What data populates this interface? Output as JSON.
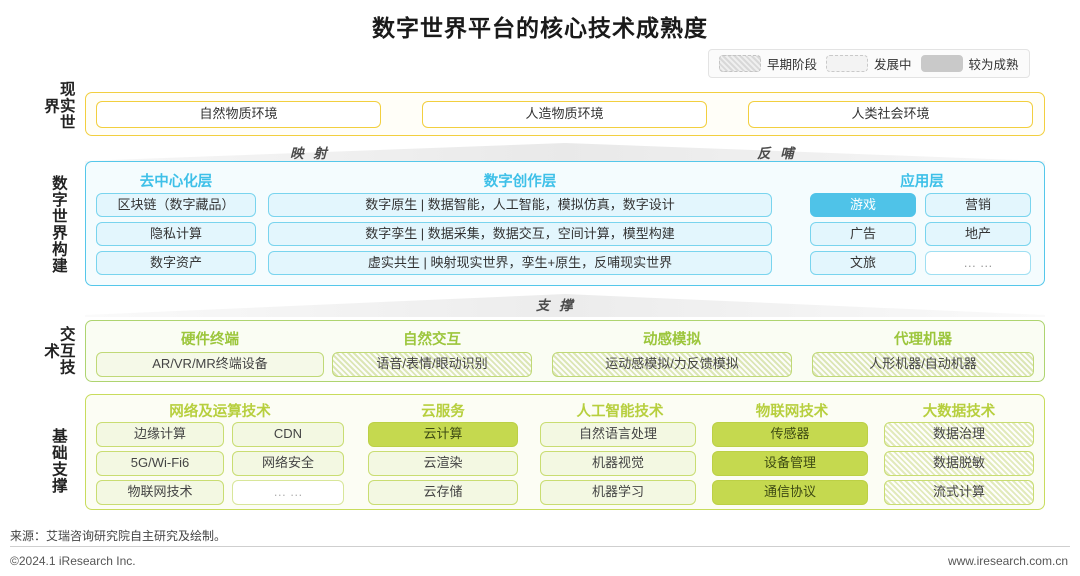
{
  "title": "数字世界平台的核心技术成熟度",
  "legend": {
    "items": [
      {
        "label": "早期阶段",
        "style": "early",
        "icon": "hatched-swatch"
      },
      {
        "label": "发展中",
        "style": "dev",
        "icon": "dashed-swatch"
      },
      {
        "label": "较为成熟",
        "style": "mature",
        "icon": "solid-swatch"
      }
    ]
  },
  "side_labels": {
    "reality": "现实世界",
    "digital": "数字世界构建",
    "interaction": "交互技术",
    "foundation": "基础支撑"
  },
  "bands": {
    "mapping": "映 射",
    "feedback": "反 哺",
    "support": "支 撑"
  },
  "reality": {
    "items": [
      {
        "label": "自然物质环境"
      },
      {
        "label": "人造物质环境"
      },
      {
        "label": "人类社会环境"
      }
    ]
  },
  "digital": {
    "columns": [
      {
        "header": "去中心化层",
        "items": [
          {
            "label": "区块链（数字藏品）",
            "state": "normal"
          },
          {
            "label": "隐私计算",
            "state": "normal"
          },
          {
            "label": "数字资产",
            "state": "normal"
          }
        ]
      },
      {
        "header": "数字创作层",
        "items": [
          {
            "label": "数字原生 | 数据智能，人工智能，模拟仿真，数字设计",
            "state": "normal"
          },
          {
            "label": "数字孪生 | 数据采集，数据交互，空间计算，模型构建",
            "state": "normal"
          },
          {
            "label": "虚实共生 | 映射现实世界，孪生+原生，反哺现实世界",
            "state": "normal"
          }
        ]
      },
      {
        "header": "应用层",
        "items": [
          {
            "label": "游戏",
            "state": "mature"
          },
          {
            "label": "营销",
            "state": "normal"
          },
          {
            "label": "广告",
            "state": "normal"
          },
          {
            "label": "地产",
            "state": "normal"
          },
          {
            "label": "文旅",
            "state": "normal"
          },
          {
            "label": "… …",
            "state": "dev"
          }
        ]
      }
    ]
  },
  "interaction": {
    "columns": [
      {
        "header": "硬件终端",
        "items": [
          {
            "label": "AR/VR/MR终端设备",
            "state": "plain"
          }
        ]
      },
      {
        "header": "自然交互",
        "items": [
          {
            "label": "语音/表情/眼动识别",
            "state": "early"
          }
        ]
      },
      {
        "header": "动感模拟",
        "items": [
          {
            "label": "运动感模拟/力反馈模拟",
            "state": "early"
          }
        ]
      },
      {
        "header": "代理机器",
        "items": [
          {
            "label": "人形机器/自动机器",
            "state": "early"
          }
        ]
      }
    ]
  },
  "foundation": {
    "columns": [
      {
        "header": "网络及运算技术",
        "items": [
          {
            "label": "边缘计算",
            "state": "normal"
          },
          {
            "label": "CDN",
            "state": "normal"
          },
          {
            "label": "5G/Wi-Fi6",
            "state": "normal"
          },
          {
            "label": "网络安全",
            "state": "normal"
          },
          {
            "label": "物联网技术",
            "state": "normal"
          },
          {
            "label": "… …",
            "state": "dev"
          }
        ]
      },
      {
        "header": "云服务",
        "items": [
          {
            "label": "云计算",
            "state": "mature"
          },
          {
            "label": "云渲染",
            "state": "normal"
          },
          {
            "label": "云存储",
            "state": "normal"
          }
        ]
      },
      {
        "header": "人工智能技术",
        "items": [
          {
            "label": "自然语言处理",
            "state": "normal"
          },
          {
            "label": "机器视觉",
            "state": "normal"
          },
          {
            "label": "机器学习",
            "state": "normal"
          }
        ]
      },
      {
        "header": "物联网技术",
        "items": [
          {
            "label": "传感器",
            "state": "mature"
          },
          {
            "label": "设备管理",
            "state": "mature"
          },
          {
            "label": "通信协议",
            "state": "mature"
          }
        ]
      },
      {
        "header": "大数据技术",
        "items": [
          {
            "label": "数据治理",
            "state": "early"
          },
          {
            "label": "数据脱敏",
            "state": "early"
          },
          {
            "label": "流式计算",
            "state": "early"
          }
        ]
      }
    ]
  },
  "footer": {
    "source": "来源：艾瑞咨询研究院自主研究及绘制。",
    "copyright": "©2024.1 iResearch Inc.",
    "website": "www.iresearch.com.cn"
  }
}
